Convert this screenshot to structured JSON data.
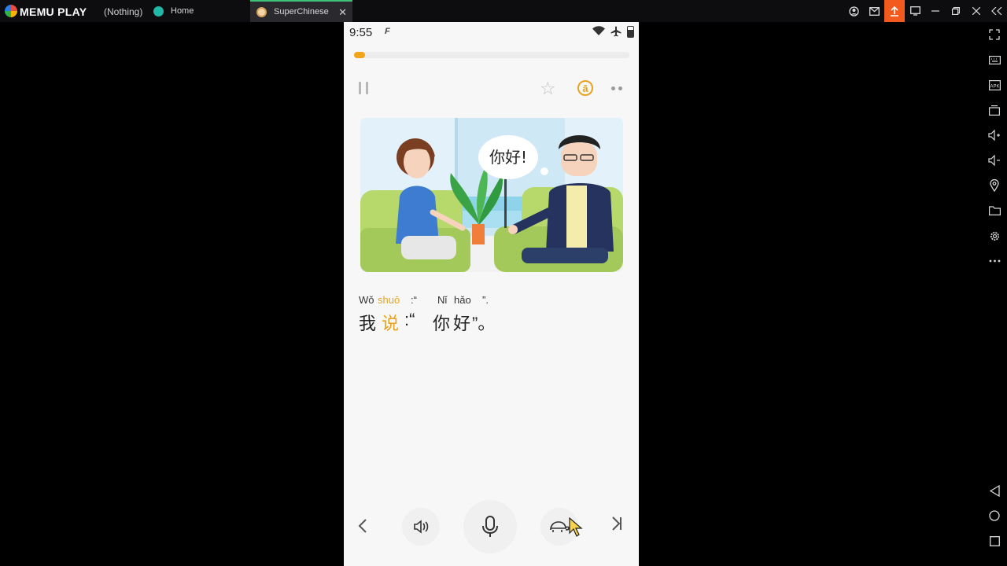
{
  "window": {
    "brand": "MEMU PLAY",
    "subtitle": "(Nothing)",
    "tabs": [
      {
        "label": "Home",
        "active": false
      },
      {
        "label": "SuperChinese",
        "active": true
      }
    ],
    "tab_close": "✕",
    "controls": [
      "account-icon",
      "mail-icon",
      "upload-icon",
      "screen-icon",
      "minimize-icon",
      "restore-icon",
      "close-icon",
      "collapse-sidebar-icon"
    ]
  },
  "sidebar": {
    "icons": [
      "fullscreen-icon",
      "keyboard-icon",
      "apk-icon",
      "multi-window-icon",
      "volume-up-icon",
      "volume-down-icon",
      "location-icon",
      "folder-icon",
      "settings-icon",
      "more-icon",
      "back-icon",
      "home-icon",
      "recents-icon"
    ]
  },
  "phone": {
    "status": {
      "time": "9:55",
      "indicator": "F"
    },
    "progress": 0.04,
    "toolbar": {
      "pinyin_toggle": "ā"
    },
    "scene": {
      "speech_bubble": "你好!"
    },
    "sentence": {
      "pinyin": [
        "Wǒ",
        "shuō",
        ":“",
        "Nǐ",
        "hǎo",
        "”."
      ],
      "hanzi": [
        "我",
        "说",
        ":“",
        "你",
        "好",
        "”。"
      ],
      "highlight_index": 1
    },
    "accent_color": "#e7a320"
  }
}
